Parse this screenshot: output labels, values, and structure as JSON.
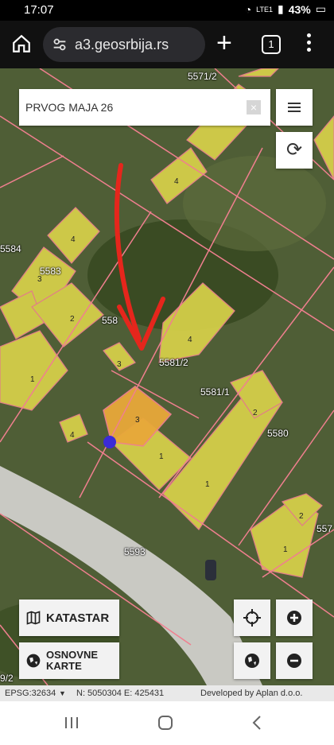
{
  "status": {
    "time": "17:07",
    "network": "LTE1",
    "battery": "43%"
  },
  "browser": {
    "url": "a3.geosrbija.rs",
    "tab_count": "1"
  },
  "search": {
    "value": "PRVOG MAJA 26",
    "clear_glyph": "×"
  },
  "map": {
    "parcel_labels": [
      "5571/2",
      "5584",
      "5583",
      "558",
      "5581/2",
      "5581/1",
      "5580",
      "5593",
      "557"
    ],
    "building_labels": [
      "4",
      "4",
      "3",
      "2",
      "1",
      "3",
      "3",
      "1",
      "4",
      "2",
      "1",
      "1",
      "4",
      "2",
      "9/2"
    ]
  },
  "controls": {
    "katastar": "KATASTAR",
    "osnovne_karte": "OSNOVNE KARTE"
  },
  "footer": {
    "epsg": "EPSG:32634",
    "coords": "N: 5050304 E: 425431",
    "credit": "Developed by Aplan d.o.o."
  },
  "colors": {
    "parcel_line": "#f07f8f",
    "building_fill": "#d8d24a",
    "selected_fill": "#e8a83a",
    "arrow": "#e5261c",
    "marker": "#3b2bd6"
  }
}
